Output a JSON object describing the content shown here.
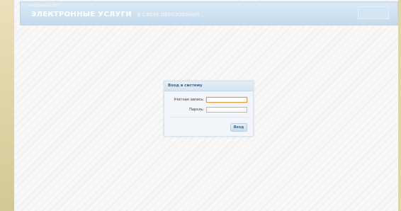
{
  "header": {
    "top_text": "Электронные услуги",
    "title": "ЭЛЕКТРОННЫЕ УСЛУГИ",
    "subtitle": "В СФЕРЕ ОБРАЗОВАНИЯ"
  },
  "login": {
    "title": "Вход в систему",
    "account_label": "Учетная запись:",
    "account_value": "",
    "password_label": "Пароль:",
    "password_value": "",
    "submit_label": "Вход"
  }
}
